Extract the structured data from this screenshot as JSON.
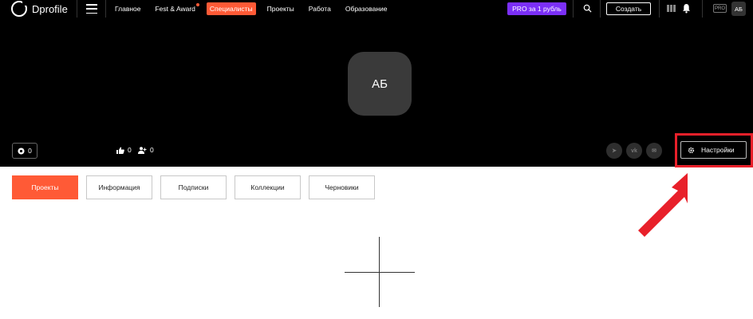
{
  "header": {
    "logo_text": "Dprofile",
    "nav": [
      {
        "label": "Главное",
        "active": false,
        "dot": false
      },
      {
        "label": "Fest & Award",
        "active": false,
        "dot": true
      },
      {
        "label": "Специалисты",
        "active": true,
        "dot": false
      },
      {
        "label": "Проекты",
        "active": false,
        "dot": false
      },
      {
        "label": "Работа",
        "active": false,
        "dot": false
      },
      {
        "label": "Образование",
        "active": false,
        "dot": false
      }
    ],
    "pro_button": "PRO за 1 рубль",
    "create_button": "Создать",
    "pro_badge": "PRO",
    "user_initials": "АБ"
  },
  "profile": {
    "initials": "АБ",
    "rating": "0",
    "likes": "0",
    "followers": "0",
    "social": [
      {
        "icon": "telegram-icon",
        "glyph": "➤"
      },
      {
        "icon": "vk-icon",
        "glyph": "vk"
      },
      {
        "icon": "mail-icon",
        "glyph": "✉"
      }
    ],
    "settings_label": "Настройки"
  },
  "tabs": [
    {
      "label": "Проекты",
      "active": true
    },
    {
      "label": "Информация",
      "active": false
    },
    {
      "label": "Подписки",
      "active": false
    },
    {
      "label": "Коллекции",
      "active": false
    },
    {
      "label": "Черновики",
      "active": false
    }
  ],
  "colors": {
    "accent": "#ff5a36",
    "pro": "#7b2ff7",
    "highlight": "#e8202a"
  }
}
